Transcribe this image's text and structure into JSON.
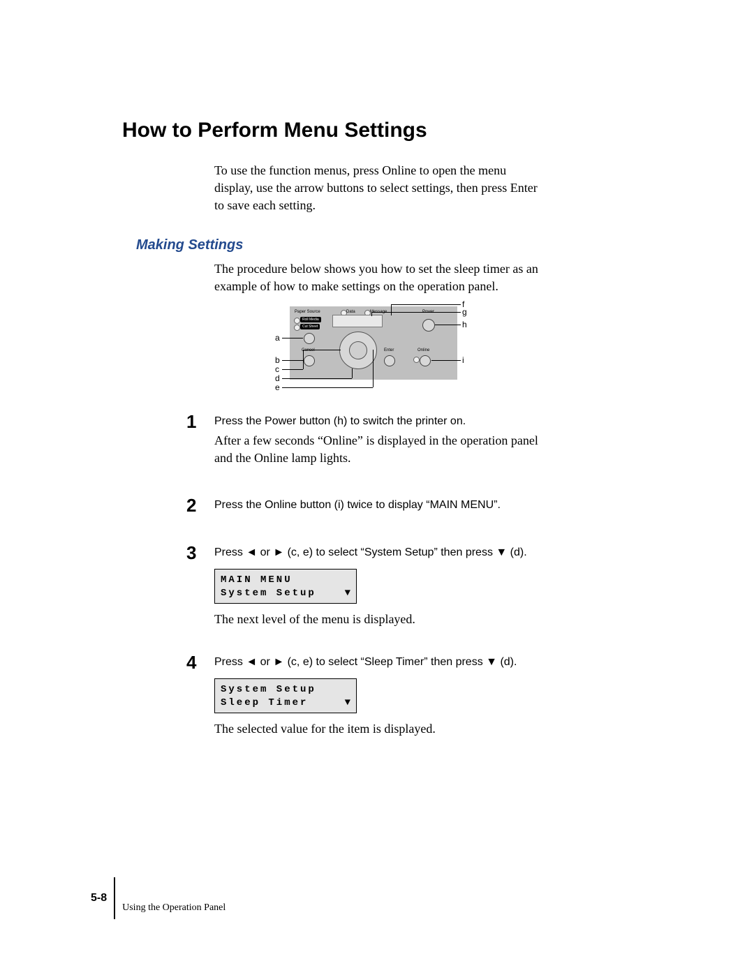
{
  "heading": "How to Perform Menu Settings",
  "intro": "To use the function menus, press Online to open the menu display, use the arrow buttons to select settings, then press Enter to save each setting.",
  "sub_heading": "Making Settings",
  "sub_intro": "The procedure below shows you how to set the sleep timer as an example of how to make settings on the operation panel.",
  "panel": {
    "labels": {
      "paper_source": "Paper Source",
      "roll_media": "Roll Media",
      "cut_sheet": "Cut Sheet",
      "data": "Data",
      "message": "Message",
      "power": "Power",
      "cancel": "Cancel",
      "enter": "Enter",
      "online": "Online"
    },
    "callouts": {
      "a": "a",
      "b": "b",
      "c": "c",
      "d": "d",
      "e": "e",
      "f": "f",
      "g": "g",
      "h": "h",
      "i": "i"
    }
  },
  "steps": [
    {
      "num": "1",
      "lead": "Press the Power button (h) to switch the printer on.",
      "follow": "After a few seconds “Online” is displayed in the operation panel and the Online lamp lights."
    },
    {
      "num": "2",
      "lead": "Press the Online button (i) twice to display “MAIN MENU”."
    },
    {
      "num": "3",
      "lead_pre": "Press ",
      "lead_mid": " or ",
      "lead_post1": " (c, e) to select “System Setup” then press ",
      "lead_post2": " (d).",
      "lcd": {
        "line1": "MAIN MENU",
        "line2": "System Setup"
      },
      "follow": "The next level of the menu is displayed."
    },
    {
      "num": "4",
      "lead_pre": "Press ",
      "lead_mid": " or ",
      "lead_post1": " (c, e) to select “Sleep Timer” then press ",
      "lead_post2": " (d).",
      "lcd": {
        "line1": "System Setup",
        "line2": "Sleep Timer"
      },
      "follow": "The selected value for the item is displayed."
    }
  ],
  "glyphs": {
    "left": "◄",
    "right": "►",
    "down": "▼"
  },
  "footer": {
    "page": "5-8",
    "section": "Using the Operation Panel"
  }
}
